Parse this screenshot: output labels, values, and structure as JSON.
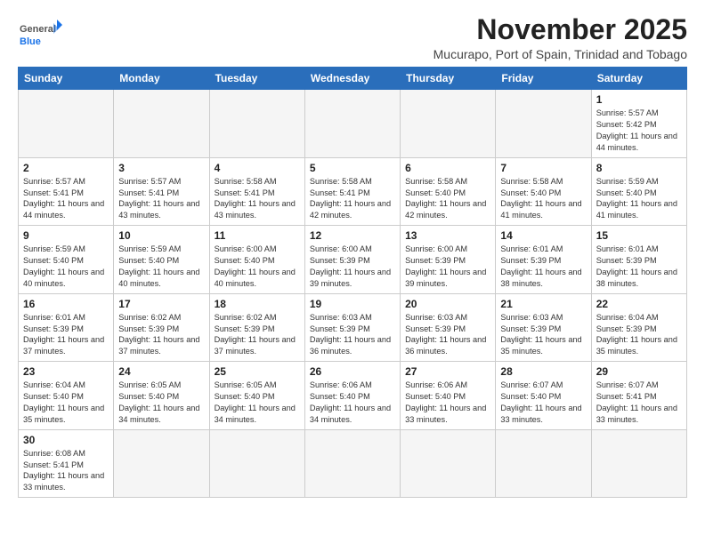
{
  "logo": {
    "line1": "General",
    "line2": "Blue"
  },
  "title": "November 2025",
  "location": "Mucurapo, Port of Spain, Trinidad and Tobago",
  "weekdays": [
    "Sunday",
    "Monday",
    "Tuesday",
    "Wednesday",
    "Thursday",
    "Friday",
    "Saturday"
  ],
  "weeks": [
    [
      {
        "day": "",
        "empty": true
      },
      {
        "day": "",
        "empty": true
      },
      {
        "day": "",
        "empty": true
      },
      {
        "day": "",
        "empty": true
      },
      {
        "day": "",
        "empty": true
      },
      {
        "day": "",
        "empty": true
      },
      {
        "day": "1",
        "sunrise": "Sunrise: 5:57 AM",
        "sunset": "Sunset: 5:42 PM",
        "daylight": "Daylight: 11 hours and 44 minutes."
      }
    ],
    [
      {
        "day": "2",
        "sunrise": "Sunrise: 5:57 AM",
        "sunset": "Sunset: 5:41 PM",
        "daylight": "Daylight: 11 hours and 44 minutes."
      },
      {
        "day": "3",
        "sunrise": "Sunrise: 5:57 AM",
        "sunset": "Sunset: 5:41 PM",
        "daylight": "Daylight: 11 hours and 43 minutes."
      },
      {
        "day": "4",
        "sunrise": "Sunrise: 5:58 AM",
        "sunset": "Sunset: 5:41 PM",
        "daylight": "Daylight: 11 hours and 43 minutes."
      },
      {
        "day": "5",
        "sunrise": "Sunrise: 5:58 AM",
        "sunset": "Sunset: 5:41 PM",
        "daylight": "Daylight: 11 hours and 42 minutes."
      },
      {
        "day": "6",
        "sunrise": "Sunrise: 5:58 AM",
        "sunset": "Sunset: 5:40 PM",
        "daylight": "Daylight: 11 hours and 42 minutes."
      },
      {
        "day": "7",
        "sunrise": "Sunrise: 5:58 AM",
        "sunset": "Sunset: 5:40 PM",
        "daylight": "Daylight: 11 hours and 41 minutes."
      },
      {
        "day": "8",
        "sunrise": "Sunrise: 5:59 AM",
        "sunset": "Sunset: 5:40 PM",
        "daylight": "Daylight: 11 hours and 41 minutes."
      }
    ],
    [
      {
        "day": "9",
        "sunrise": "Sunrise: 5:59 AM",
        "sunset": "Sunset: 5:40 PM",
        "daylight": "Daylight: 11 hours and 40 minutes."
      },
      {
        "day": "10",
        "sunrise": "Sunrise: 5:59 AM",
        "sunset": "Sunset: 5:40 PM",
        "daylight": "Daylight: 11 hours and 40 minutes."
      },
      {
        "day": "11",
        "sunrise": "Sunrise: 6:00 AM",
        "sunset": "Sunset: 5:40 PM",
        "daylight": "Daylight: 11 hours and 40 minutes."
      },
      {
        "day": "12",
        "sunrise": "Sunrise: 6:00 AM",
        "sunset": "Sunset: 5:39 PM",
        "daylight": "Daylight: 11 hours and 39 minutes."
      },
      {
        "day": "13",
        "sunrise": "Sunrise: 6:00 AM",
        "sunset": "Sunset: 5:39 PM",
        "daylight": "Daylight: 11 hours and 39 minutes."
      },
      {
        "day": "14",
        "sunrise": "Sunrise: 6:01 AM",
        "sunset": "Sunset: 5:39 PM",
        "daylight": "Daylight: 11 hours and 38 minutes."
      },
      {
        "day": "15",
        "sunrise": "Sunrise: 6:01 AM",
        "sunset": "Sunset: 5:39 PM",
        "daylight": "Daylight: 11 hours and 38 minutes."
      }
    ],
    [
      {
        "day": "16",
        "sunrise": "Sunrise: 6:01 AM",
        "sunset": "Sunset: 5:39 PM",
        "daylight": "Daylight: 11 hours and 37 minutes."
      },
      {
        "day": "17",
        "sunrise": "Sunrise: 6:02 AM",
        "sunset": "Sunset: 5:39 PM",
        "daylight": "Daylight: 11 hours and 37 minutes."
      },
      {
        "day": "18",
        "sunrise": "Sunrise: 6:02 AM",
        "sunset": "Sunset: 5:39 PM",
        "daylight": "Daylight: 11 hours and 37 minutes."
      },
      {
        "day": "19",
        "sunrise": "Sunrise: 6:03 AM",
        "sunset": "Sunset: 5:39 PM",
        "daylight": "Daylight: 11 hours and 36 minutes."
      },
      {
        "day": "20",
        "sunrise": "Sunrise: 6:03 AM",
        "sunset": "Sunset: 5:39 PM",
        "daylight": "Daylight: 11 hours and 36 minutes."
      },
      {
        "day": "21",
        "sunrise": "Sunrise: 6:03 AM",
        "sunset": "Sunset: 5:39 PM",
        "daylight": "Daylight: 11 hours and 35 minutes."
      },
      {
        "day": "22",
        "sunrise": "Sunrise: 6:04 AM",
        "sunset": "Sunset: 5:39 PM",
        "daylight": "Daylight: 11 hours and 35 minutes."
      }
    ],
    [
      {
        "day": "23",
        "sunrise": "Sunrise: 6:04 AM",
        "sunset": "Sunset: 5:40 PM",
        "daylight": "Daylight: 11 hours and 35 minutes."
      },
      {
        "day": "24",
        "sunrise": "Sunrise: 6:05 AM",
        "sunset": "Sunset: 5:40 PM",
        "daylight": "Daylight: 11 hours and 34 minutes."
      },
      {
        "day": "25",
        "sunrise": "Sunrise: 6:05 AM",
        "sunset": "Sunset: 5:40 PM",
        "daylight": "Daylight: 11 hours and 34 minutes."
      },
      {
        "day": "26",
        "sunrise": "Sunrise: 6:06 AM",
        "sunset": "Sunset: 5:40 PM",
        "daylight": "Daylight: 11 hours and 34 minutes."
      },
      {
        "day": "27",
        "sunrise": "Sunrise: 6:06 AM",
        "sunset": "Sunset: 5:40 PM",
        "daylight": "Daylight: 11 hours and 33 minutes."
      },
      {
        "day": "28",
        "sunrise": "Sunrise: 6:07 AM",
        "sunset": "Sunset: 5:40 PM",
        "daylight": "Daylight: 11 hours and 33 minutes."
      },
      {
        "day": "29",
        "sunrise": "Sunrise: 6:07 AM",
        "sunset": "Sunset: 5:41 PM",
        "daylight": "Daylight: 11 hours and 33 minutes."
      }
    ],
    [
      {
        "day": "30",
        "sunrise": "Sunrise: 6:08 AM",
        "sunset": "Sunset: 5:41 PM",
        "daylight": "Daylight: 11 hours and 33 minutes."
      },
      {
        "day": "",
        "empty": true
      },
      {
        "day": "",
        "empty": true
      },
      {
        "day": "",
        "empty": true
      },
      {
        "day": "",
        "empty": true
      },
      {
        "day": "",
        "empty": true
      },
      {
        "day": "",
        "empty": true
      }
    ]
  ]
}
